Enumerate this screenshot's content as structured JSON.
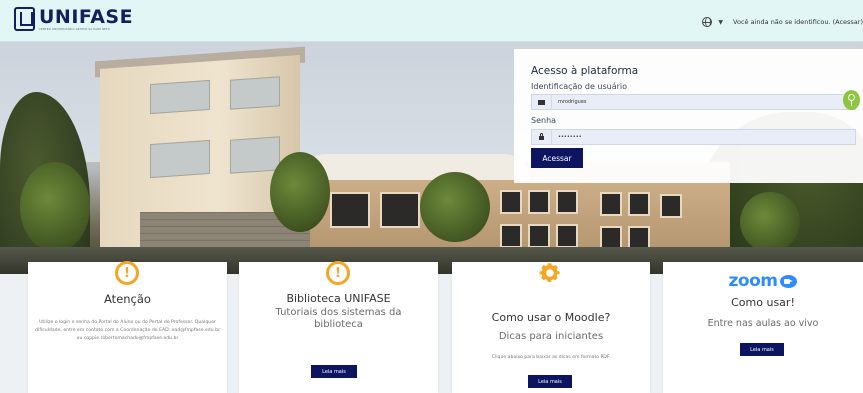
{
  "header": {
    "logo_name": "UNIFASE",
    "logo_tagline": "CENTRO UNIVERSITÁRIO ARTHUR SÁ EARP NETO",
    "login_status": "Você ainda não se identificou. (Acessar)"
  },
  "login": {
    "title": "Acesso à plataforma",
    "username_label": "Identificação de usuário",
    "username_value": "mrodrigues",
    "password_label": "Senha",
    "password_value": "••••••••",
    "submit_label": "Acessar"
  },
  "cards": [
    {
      "title": "Atenção",
      "body": "Utilize o login e senha do Portal do Aluno ou do Portal do Professor. Qualquer dificuldade, entre em contato com a Coordenação de EAD: ead@fmpfase.edu.br ou coppie.robertomachado@fmpfase.edu.br"
    },
    {
      "title": "Biblioteca UNIFASE",
      "subtitle": "Tutoriais dos sistemas da biblioteca",
      "button_label": "Leia mais"
    },
    {
      "title": "Como usar o Moodle?",
      "subtitle": "Dicas para iniciantes",
      "body": "Clique abaixo para baixar as dicas em formato PDF.",
      "button_label": "Leia mais"
    },
    {
      "title": "Como usar!",
      "logo_text": "zoom",
      "subtitle": "Entre nas aulas ao vivo",
      "button_label": "Leia mais"
    }
  ],
  "icons": {
    "warning_color": "#f5a623",
    "gear_color": "#f5a623",
    "zoom_color": "#2d8cff",
    "accent": "#0d1460"
  }
}
